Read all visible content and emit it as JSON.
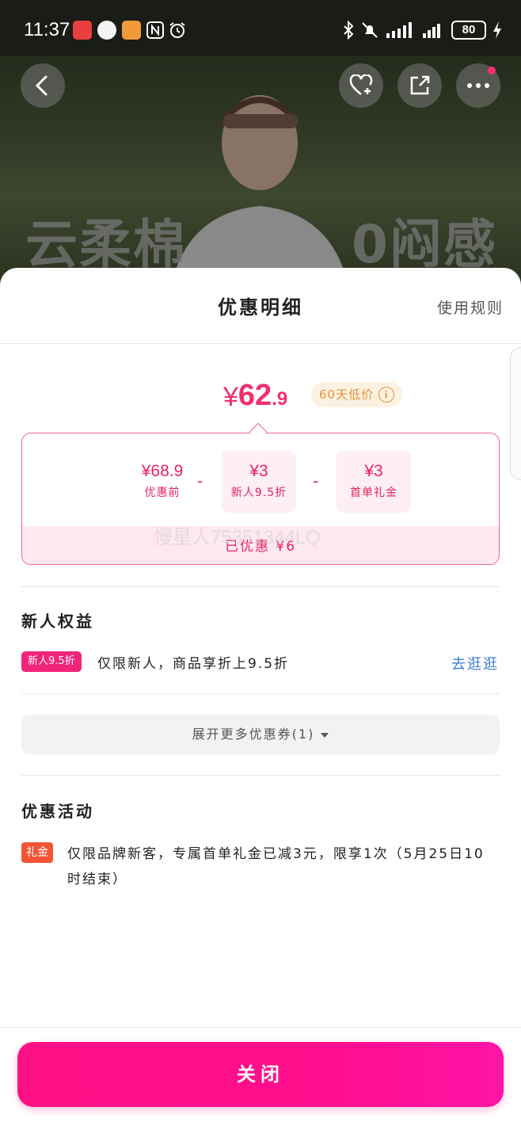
{
  "status_bar": {
    "time": "11:37",
    "battery": "80"
  },
  "hero": {
    "text_left": "云柔棉",
    "text_right": "0闷感"
  },
  "sheet": {
    "title": "优惠明细",
    "rules_link": "使用规则",
    "price": {
      "currency": "¥",
      "integer": "62",
      "decimal": ".9"
    },
    "low_price_badge": "60天低价",
    "breakdown": [
      {
        "amount": "¥68.9",
        "label": "优惠前"
      },
      {
        "amount": "¥3",
        "label": "新人9.5折"
      },
      {
        "amount": "¥3",
        "label": "首单礼金"
      }
    ],
    "operator": "-",
    "saved": "已优惠 ¥6",
    "watermark": "慢星人75351344LQ"
  },
  "newbie": {
    "title": "新人权益",
    "tag": "新人9.5折",
    "text": "仅限新人，商品享折上9.5折",
    "link": "去逛逛"
  },
  "expand": {
    "label": "展开更多优惠券(1)"
  },
  "activity": {
    "title": "优惠活动",
    "tag": "礼金",
    "text": "仅限品牌新客，专属首单礼金已减3元，限享1次（5月25日10时结束）"
  },
  "footer": {
    "close_label": "关闭"
  },
  "colors": {
    "accent": "#f0306c",
    "button": "#ff1186",
    "link": "#3d7fd4",
    "badge_text": "#e3933a"
  }
}
